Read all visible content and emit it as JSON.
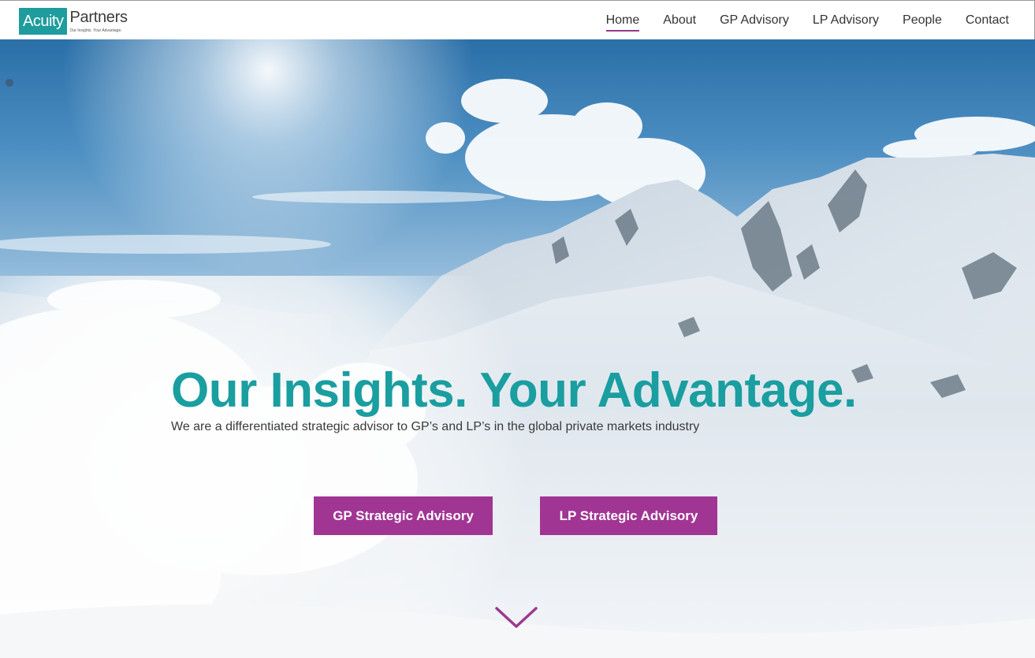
{
  "header": {
    "logo": {
      "box_text": "Acuity",
      "word": "Partners",
      "tagline": "Our Insights. Your Advantage."
    },
    "nav": [
      {
        "label": "Home",
        "active": true
      },
      {
        "label": "About",
        "active": false
      },
      {
        "label": "GP Advisory",
        "active": false
      },
      {
        "label": "LP Advisory",
        "active": false
      },
      {
        "label": "People",
        "active": false
      },
      {
        "label": "Contact",
        "active": false
      }
    ]
  },
  "hero": {
    "headline": "Our Insights. Your Advantage.",
    "subline": "We are a differentiated strategic advisor to GP’s and LP’s in the global private markets industry",
    "buttons": {
      "gp": "GP Strategic Advisory",
      "lp": "LP Strategic Advisory"
    },
    "scroll_icon": "chevron-down-icon"
  },
  "colors": {
    "brand_teal": "#1a9ea0",
    "button_purple": "#a13594",
    "nav_underline": "#8e3a8f",
    "chevron": "#9b3a8e"
  }
}
